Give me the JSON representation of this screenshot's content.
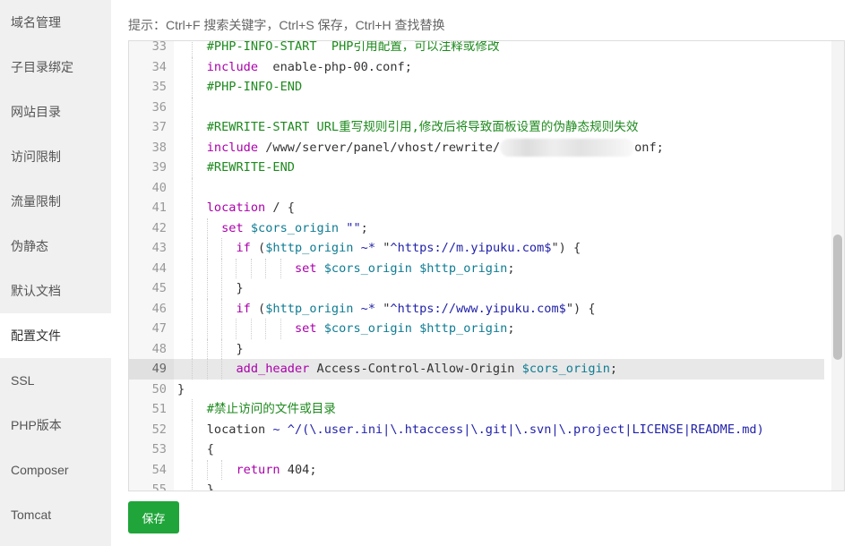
{
  "sidebar": {
    "items": [
      "域名管理",
      "子目录绑定",
      "网站目录",
      "访问限制",
      "流量限制",
      "伪静态",
      "默认文档",
      "配置文件",
      "SSL",
      "PHP版本",
      "Composer",
      "Tomcat"
    ],
    "active": "配置文件"
  },
  "hint": "提示：Ctrl+F 搜索关键字，Ctrl+S 保存，Ctrl+H 查找替换",
  "editor": {
    "active_line": "49",
    "lines": [
      {
        "n": "33",
        "i": 4,
        "t": [
          [
            "cm",
            "#PHP-INFO-START  PHP引用配置，可以注释或修改"
          ]
        ]
      },
      {
        "n": "34",
        "i": 4,
        "t": [
          [
            "kw",
            "include"
          ],
          [
            "",
            "  enable-php-00.conf;"
          ]
        ]
      },
      {
        "n": "35",
        "i": 4,
        "t": [
          [
            "cm",
            "#PHP-INFO-END"
          ]
        ]
      },
      {
        "n": "36",
        "i": 4,
        "t": []
      },
      {
        "n": "37",
        "i": 4,
        "t": [
          [
            "cm",
            "#REWRITE-START URL重写规则引用,修改后将导致面板设置的伪静态规则失效"
          ]
        ]
      },
      {
        "n": "38",
        "i": 4,
        "t": [
          [
            "kw",
            "include"
          ],
          [
            "",
            " /www/server/panel/vhost/rewrite/"
          ],
          [
            "blur",
            ""
          ],
          [
            "",
            "onf;"
          ]
        ]
      },
      {
        "n": "39",
        "i": 4,
        "t": [
          [
            "cm",
            "#REWRITE-END"
          ]
        ]
      },
      {
        "n": "40",
        "i": 4,
        "t": []
      },
      {
        "n": "41",
        "i": 4,
        "t": [
          [
            "kw",
            "location"
          ],
          [
            "",
            " / {"
          ]
        ]
      },
      {
        "n": "42",
        "i": 6,
        "t": [
          [
            "kw",
            "set"
          ],
          [
            "",
            " "
          ],
          [
            "var",
            "$cors_origin"
          ],
          [
            "",
            " "
          ],
          [
            "str",
            "\"\""
          ],
          [
            "",
            ";"
          ]
        ]
      },
      {
        "n": "43",
        "i": 8,
        "t": [
          [
            "kw",
            "if"
          ],
          [
            "",
            " ("
          ],
          [
            "var",
            "$http_origin"
          ],
          [
            "",
            " "
          ],
          [
            "op",
            "~*"
          ],
          [
            "",
            " \""
          ],
          [
            "str",
            "^https://m.yipuku.com$"
          ],
          [
            "",
            "\") {"
          ]
        ]
      },
      {
        "n": "44",
        "i": 16,
        "t": [
          [
            "kw",
            "set"
          ],
          [
            "",
            " "
          ],
          [
            "var",
            "$cors_origin"
          ],
          [
            "",
            " "
          ],
          [
            "var",
            "$http_origin"
          ],
          [
            "",
            ";"
          ]
        ]
      },
      {
        "n": "45",
        "i": 8,
        "t": [
          [
            "",
            "}"
          ]
        ]
      },
      {
        "n": "46",
        "i": 8,
        "t": [
          [
            "kw",
            "if"
          ],
          [
            "",
            " ("
          ],
          [
            "var",
            "$http_origin"
          ],
          [
            "",
            " "
          ],
          [
            "op",
            "~*"
          ],
          [
            "",
            " \""
          ],
          [
            "str",
            "^https://www.yipuku.com$"
          ],
          [
            "",
            "\") {"
          ]
        ]
      },
      {
        "n": "47",
        "i": 16,
        "t": [
          [
            "kw",
            "set"
          ],
          [
            "",
            " "
          ],
          [
            "var",
            "$cors_origin"
          ],
          [
            "",
            " "
          ],
          [
            "var",
            "$http_origin"
          ],
          [
            "",
            ";"
          ]
        ]
      },
      {
        "n": "48",
        "i": 8,
        "t": [
          [
            "",
            "}"
          ]
        ]
      },
      {
        "n": "49",
        "i": 8,
        "t": [
          [
            "kw",
            "add_header"
          ],
          [
            "",
            " Access-Control-Allow-Origin "
          ],
          [
            "var",
            "$cors_origin"
          ],
          [
            "",
            ";"
          ]
        ]
      },
      {
        "n": "50",
        "i": 0,
        "t": [
          [
            "",
            "}"
          ]
        ]
      },
      {
        "n": "51",
        "i": 4,
        "t": [
          [
            "cm",
            "#禁止访问的文件或目录"
          ]
        ]
      },
      {
        "n": "52",
        "i": 4,
        "t": [
          [
            "",
            "location "
          ],
          [
            "op",
            "~ ^/(\\.user.ini|\\.htaccess|\\.git|\\.svn|\\.project|LICENSE|README.md)"
          ]
        ]
      },
      {
        "n": "53",
        "i": 4,
        "t": [
          [
            "",
            "{"
          ]
        ]
      },
      {
        "n": "54",
        "i": 8,
        "t": [
          [
            "kw",
            "return"
          ],
          [
            "",
            " 404;"
          ]
        ]
      },
      {
        "n": "55",
        "i": 4,
        "t": [
          [
            "",
            "}"
          ]
        ]
      }
    ]
  },
  "save_label": "保存",
  "colors": {
    "save": "#20a53a",
    "keyword": "#aa00aa",
    "comment": "#1e8a1e",
    "variable": "#0f7c93",
    "string": "#2222aa"
  }
}
